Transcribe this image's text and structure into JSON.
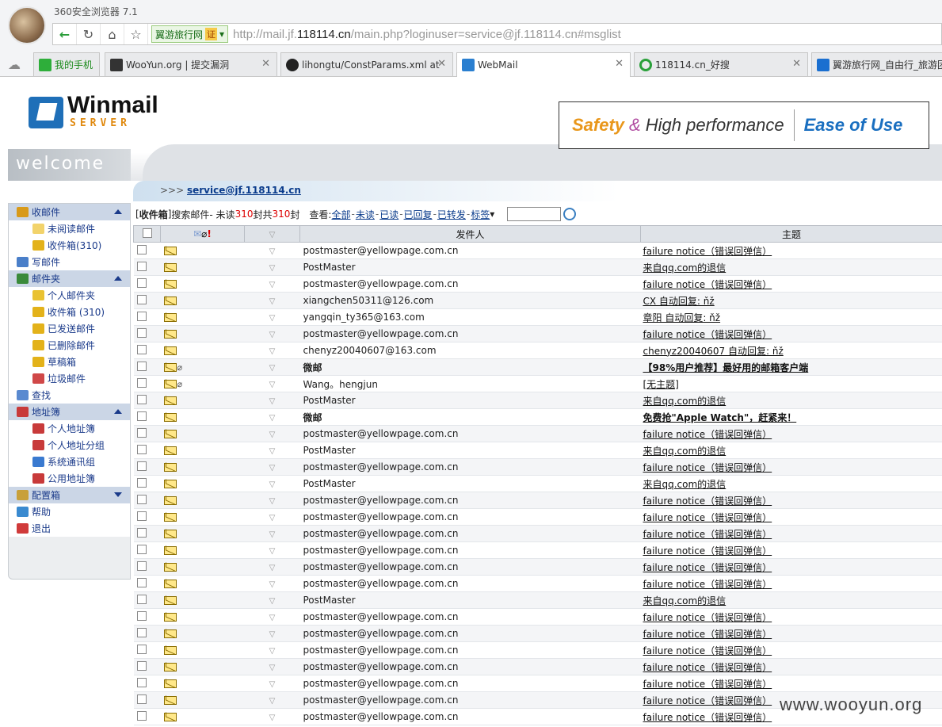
{
  "browser": {
    "title": "360安全浏览器 7.1",
    "site_badge": "翼游旅行网",
    "cert_badge": "证",
    "url_prefix": "http://mail.jf.",
    "url_host": "118114.cn",
    "url_rest": "/main.php?loginuser=service@jf.118114.cn#msglist",
    "tabs": [
      "我的手机",
      "WooYun.org | 提交漏洞",
      "lihongtu/ConstParams.xml at",
      "WebMail",
      "118114.cn_好搜",
      "翼游旅行网_自由行_旅游团"
    ]
  },
  "banner": {
    "logo": "Winmail",
    "logo_sub": "SERVER",
    "welcome": "welcome",
    "slogan_1": "Safety",
    "slogan_amp": "&",
    "slogan_2": "High performance",
    "slogan_3": "Ease of Use"
  },
  "userbar": {
    "prefix": ">>> ",
    "user": "service@jf.118114.cn"
  },
  "sidebar": [
    {
      "label": "收邮件",
      "type": "group",
      "arrow": "up",
      "color": "#d89a1a"
    },
    {
      "label": "未阅读邮件",
      "type": "sub",
      "color": "#f2d36b"
    },
    {
      "label": "收件箱(310)",
      "type": "sub",
      "color": "#e3b21a"
    },
    {
      "label": "写邮件",
      "type": "item",
      "color": "#4a7fc9"
    },
    {
      "label": "邮件夹",
      "type": "group",
      "arrow": "up",
      "color": "#3a8a3a"
    },
    {
      "label": "个人邮件夹",
      "type": "sub",
      "color": "#e9c232"
    },
    {
      "label": "收件箱 (310)",
      "type": "sub",
      "color": "#e3b21a"
    },
    {
      "label": "已发送邮件",
      "type": "sub",
      "color": "#e3b21a"
    },
    {
      "label": "已删除邮件",
      "type": "sub",
      "color": "#e3b21a"
    },
    {
      "label": "草稿箱",
      "type": "sub",
      "color": "#e3b21a"
    },
    {
      "label": "垃圾邮件",
      "type": "sub",
      "color": "#d04848"
    },
    {
      "label": "查找",
      "type": "item",
      "color": "#5a8ad0"
    },
    {
      "label": "地址簿",
      "type": "group",
      "arrow": "up",
      "color": "#c83a3a"
    },
    {
      "label": "个人地址簿",
      "type": "sub",
      "color": "#c83a3a"
    },
    {
      "label": "个人地址分组",
      "type": "sub",
      "color": "#c83a3a"
    },
    {
      "label": "系统通讯组",
      "type": "sub",
      "color": "#3a7ad0"
    },
    {
      "label": "公用地址簿",
      "type": "sub",
      "color": "#c83a3a"
    },
    {
      "label": "配置箱",
      "type": "group",
      "arrow": "down",
      "color": "#c8a03a"
    },
    {
      "label": "帮助",
      "type": "item",
      "color": "#3a8ad0"
    },
    {
      "label": "退出",
      "type": "item",
      "color": "#d03a3a"
    }
  ],
  "toolbar": {
    "folder": "收件箱",
    "search": "搜索邮件",
    "unread_prefix": " - 未读",
    "unread_count": "310",
    "unit": "封",
    "total_prefix": " 共",
    "total_count": "310",
    "view_label": "查看: ",
    "filters": [
      "全部",
      "未读",
      "已读",
      "已回复",
      "已转发",
      "标签"
    ]
  },
  "table": {
    "headers": {
      "sender": "发件人",
      "subject": "主题"
    },
    "rows": [
      {
        "sender": "postmaster@yellowpage.com.cn",
        "subject": "failure notice（错误回弹信）",
        "bold": false,
        "clip": false
      },
      {
        "sender": "PostMaster",
        "subject": "来自qq.com的退信",
        "bold": false,
        "clip": false
      },
      {
        "sender": "postmaster@yellowpage.com.cn",
        "subject": "failure notice（错误回弹信）",
        "bold": false,
        "clip": false
      },
      {
        "sender": "xiangchen50311@126.com",
        "subject": "CX 自动回复: ňž",
        "bold": false,
        "clip": false
      },
      {
        "sender": "yangqin_ty365@163.com",
        "subject": "章阳 自动回复: ňž",
        "bold": false,
        "clip": false
      },
      {
        "sender": "postmaster@yellowpage.com.cn",
        "subject": "failure notice（错误回弹信）",
        "bold": false,
        "clip": false
      },
      {
        "sender": "chenyz20040607@163.com",
        "subject": "chenyz20040607 自动回复: ňž",
        "bold": false,
        "clip": false
      },
      {
        "sender": "微邮",
        "subject": "【98%用户推荐】最好用的邮箱客户端",
        "bold": true,
        "clip": true
      },
      {
        "sender": "Wang。hengjun",
        "subject": "[无主题]",
        "bold": false,
        "clip": true
      },
      {
        "sender": "PostMaster",
        "subject": "来自qq.com的退信",
        "bold": false,
        "clip": false
      },
      {
        "sender": "微邮",
        "subject": "免费抢\"Apple Watch\"，赶紧来！",
        "bold": true,
        "clip": false
      },
      {
        "sender": "postmaster@yellowpage.com.cn",
        "subject": "failure notice（错误回弹信）",
        "bold": false,
        "clip": false
      },
      {
        "sender": "PostMaster",
        "subject": "来自qq.com的退信",
        "bold": false,
        "clip": false
      },
      {
        "sender": "postmaster@yellowpage.com.cn",
        "subject": "failure notice（错误回弹信）",
        "bold": false,
        "clip": false
      },
      {
        "sender": "PostMaster",
        "subject": "来自qq.com的退信",
        "bold": false,
        "clip": false
      },
      {
        "sender": "postmaster@yellowpage.com.cn",
        "subject": "failure notice（错误回弹信）",
        "bold": false,
        "clip": false
      },
      {
        "sender": "postmaster@yellowpage.com.cn",
        "subject": "failure notice（错误回弹信）",
        "bold": false,
        "clip": false
      },
      {
        "sender": "postmaster@yellowpage.com.cn",
        "subject": "failure notice（错误回弹信）",
        "bold": false,
        "clip": false
      },
      {
        "sender": "postmaster@yellowpage.com.cn",
        "subject": "failure notice（错误回弹信）",
        "bold": false,
        "clip": false
      },
      {
        "sender": "postmaster@yellowpage.com.cn",
        "subject": "failure notice（错误回弹信）",
        "bold": false,
        "clip": false
      },
      {
        "sender": "postmaster@yellowpage.com.cn",
        "subject": "failure notice（错误回弹信）",
        "bold": false,
        "clip": false
      },
      {
        "sender": "PostMaster",
        "subject": "来自qq.com的退信",
        "bold": false,
        "clip": false
      },
      {
        "sender": "postmaster@yellowpage.com.cn",
        "subject": "failure notice（错误回弹信）",
        "bold": false,
        "clip": false
      },
      {
        "sender": "postmaster@yellowpage.com.cn",
        "subject": "failure notice（错误回弹信）",
        "bold": false,
        "clip": false
      },
      {
        "sender": "postmaster@yellowpage.com.cn",
        "subject": "failure notice（错误回弹信）",
        "bold": false,
        "clip": false
      },
      {
        "sender": "postmaster@yellowpage.com.cn",
        "subject": "failure notice（错误回弹信）",
        "bold": false,
        "clip": false
      },
      {
        "sender": "postmaster@yellowpage.com.cn",
        "subject": "failure notice（错误回弹信）",
        "bold": false,
        "clip": false
      },
      {
        "sender": "postmaster@yellowpage.com.cn",
        "subject": "failure notice（错误回弹信）",
        "bold": false,
        "clip": false
      },
      {
        "sender": "postmaster@yellowpage.com.cn",
        "subject": "failure notice（错误回弹信）",
        "bold": false,
        "clip": false
      }
    ]
  },
  "watermark": "www.wooyun.org"
}
